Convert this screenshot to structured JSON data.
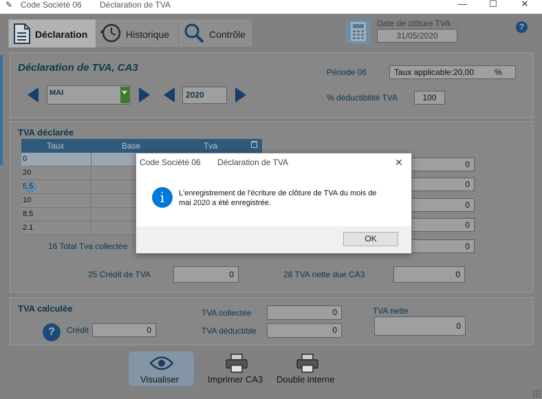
{
  "window": {
    "app_title": "Code Société 06",
    "doc_title": "Déclaration de TVA",
    "minimize": "—",
    "maximize": "☐",
    "close": "✕"
  },
  "tabs": [
    {
      "label": "Déclaration",
      "icon": "document-icon",
      "active": true
    },
    {
      "label": "Historique",
      "icon": "clock-icon",
      "active": false
    },
    {
      "label": "Contrôle",
      "icon": "magnifier-icon",
      "active": false
    }
  ],
  "closing_date": {
    "label": "Date de clôture TVA",
    "value": "31/05/2020"
  },
  "help_icon": "?",
  "declaration": {
    "title": "Déclaration de TVA, CA3",
    "month": "MAI",
    "year": "2020",
    "period_label": "Période 06",
    "rate_label": "Taux applicable:",
    "rate_value": "20,00",
    "rate_unit": "%",
    "deductibility_label": "% déductibilité TVA",
    "deductibility_value": "100"
  },
  "tva_declaree": {
    "title": "TVA déclarée",
    "columns": [
      "Taux",
      "Base",
      "Tva"
    ],
    "rows": [
      "0",
      "20",
      "5.5",
      "10",
      "8.5",
      "2.1"
    ],
    "right_values": [
      "0",
      "0",
      "0",
      "0"
    ],
    "total_label": "16 Total Tva collectée",
    "total_value": "0",
    "credit_label": "25 Crédit de TVA",
    "credit_value": "0",
    "net_label": "28 TVA nette due CA3",
    "net_value": "0"
  },
  "tva_calculee": {
    "title": "TVA calculée",
    "credit_label": "Crédit",
    "credit_value": "0",
    "collected_label": "TVA collectée",
    "collected_value": "0",
    "deductible_label": "TVA déductible",
    "deductible_value": "0",
    "net_label": "TVA nette",
    "net_value": "0"
  },
  "actions": {
    "preview": "Visualiser",
    "print": "Imprimer CA3",
    "double": "Double interne"
  },
  "dialog": {
    "app_title": "Code Société 06",
    "doc_title": "Déclaration de TVA",
    "message_line1": "L'enregistrement de l'écriture de clôture de TVA du mois de",
    "message_line2": "mai 2020 a été enregistrée.",
    "ok": "OK",
    "close": "✕"
  },
  "colors": {
    "accent": "#173f6c",
    "info": "#0078d7",
    "grid_header": "#2f5a7c"
  }
}
